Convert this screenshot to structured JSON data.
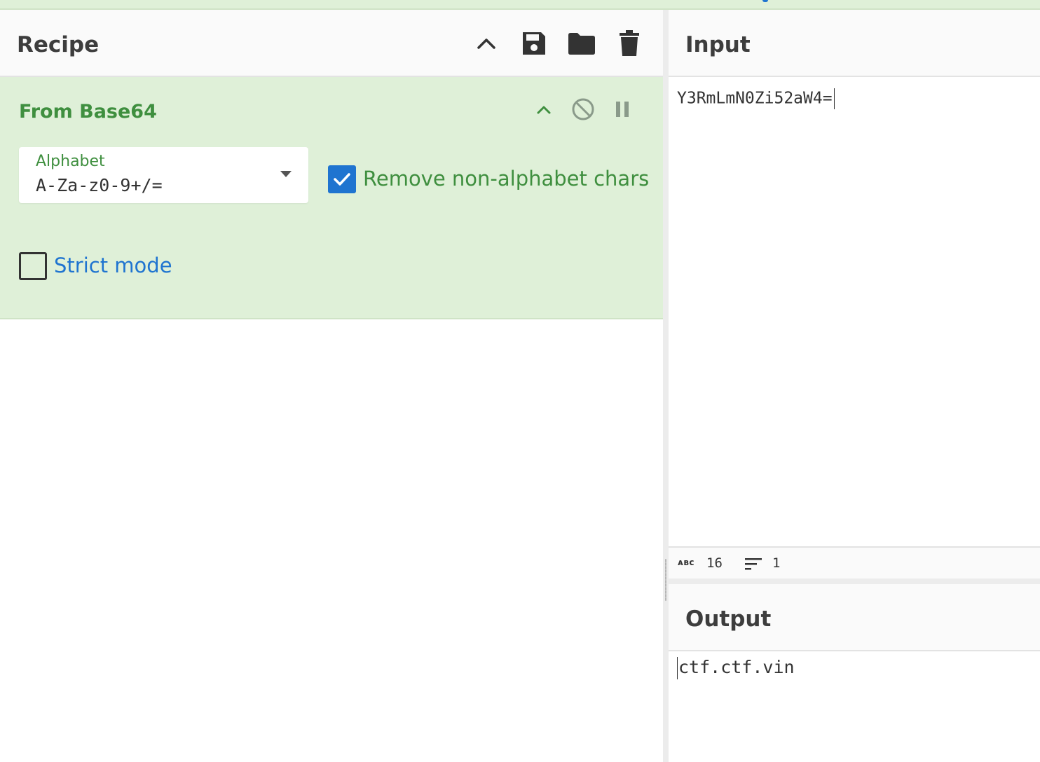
{
  "recipe": {
    "title": "Recipe"
  },
  "operation": {
    "title": "From Base64",
    "alphabet_label": "Alphabet",
    "alphabet_value": "A-Za-z0-9+/=",
    "remove_non_alphabet_label": "Remove non-alphabet chars",
    "remove_non_alphabet_checked": true,
    "strict_mode_label": "Strict mode",
    "strict_mode_checked": false
  },
  "input": {
    "title": "Input",
    "text": "Y3RmLmN0Zi52aW4=",
    "length": "16",
    "lines": "1"
  },
  "output": {
    "title": "Output",
    "text": "ctf.ctf.vin"
  },
  "colors": {
    "operation_bg": "#dff0d8",
    "operation_accent": "#3f8f3f",
    "checkbox_blue": "#1f74d0",
    "header_bg": "#fafafa"
  },
  "icons": {
    "recipe_header": [
      "chevron-up-icon",
      "save-icon",
      "folder-icon",
      "trash-icon"
    ],
    "operation": [
      "chevron-up-icon",
      "disable-icon",
      "pause-icon"
    ],
    "status": [
      "abc-icon",
      "lines-icon"
    ]
  }
}
